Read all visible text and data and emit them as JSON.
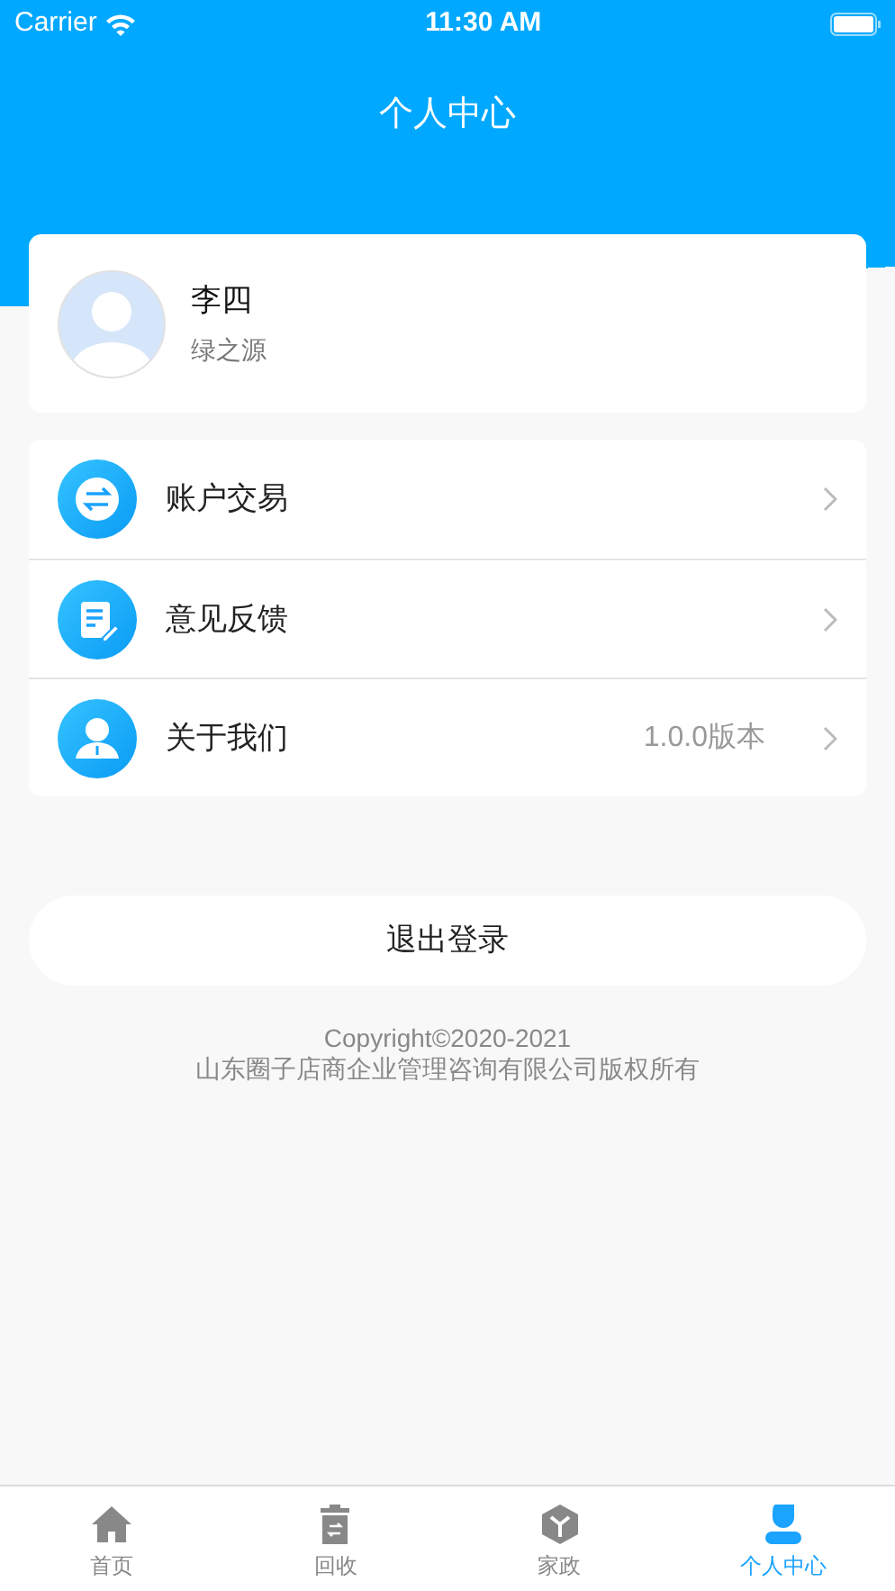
{
  "status_bar": {
    "carrier": "Carrier",
    "time": "11:30 AM"
  },
  "header": {
    "title": "个人中心"
  },
  "profile": {
    "name": "李四",
    "subtitle": "绿之源"
  },
  "menu": [
    {
      "label": "账户交易"
    },
    {
      "label": "意见反馈"
    },
    {
      "label": "关于我们",
      "value": "1.0.0版本"
    }
  ],
  "logout_button": "退出登录",
  "footer": [
    "Copyright©2020-2021",
    "山东圈子店商企业管理咨询有限公司版权所有"
  ],
  "tabs": [
    {
      "label": "首页",
      "selected": false
    },
    {
      "label": "回收",
      "selected": false
    },
    {
      "label": "家政",
      "selected": false
    },
    {
      "label": "个人中心",
      "selected": true
    }
  ]
}
